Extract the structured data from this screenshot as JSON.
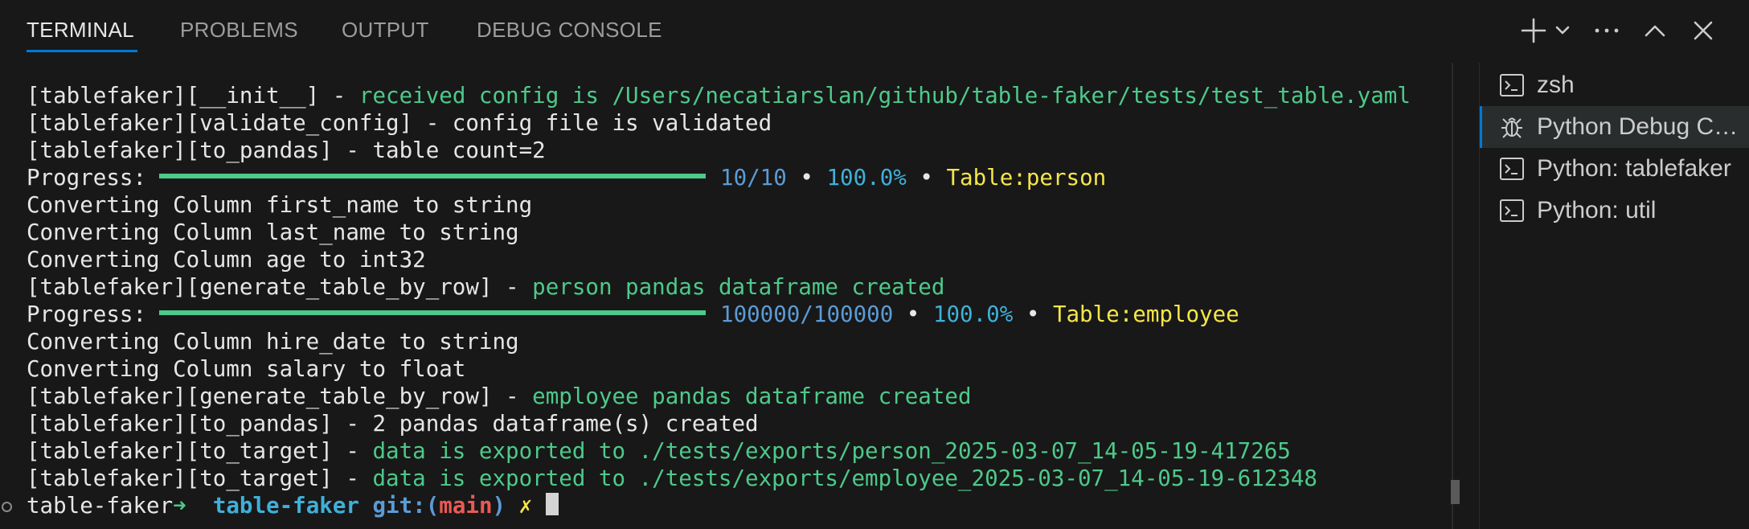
{
  "tabs": [
    {
      "label": "TERMINAL",
      "active": true
    },
    {
      "label": "PROBLEMS",
      "active": false
    },
    {
      "label": "OUTPUT",
      "active": false
    },
    {
      "label": "DEBUG CONSOLE",
      "active": false
    }
  ],
  "toolbar": {
    "icons": [
      "plus-icon",
      "chevron-down-icon",
      "ellipsis-icon",
      "chevron-up-icon",
      "close-icon"
    ]
  },
  "terminal": {
    "lines": {
      "l1": {
        "prefix": "[tablefaker][__init__] - ",
        "msg": "received config is /Users/necatiarslan/github/table-faker/tests/test_table.yaml"
      },
      "l2": {
        "text": "[tablefaker][validate_config] - config file is validated"
      },
      "l3": {
        "text": "[tablefaker][to_pandas] - table count=2"
      },
      "p1": {
        "label": "Progress:",
        "count": "10/10",
        "sep": " • ",
        "pct": "100.0%",
        "sep2": " • ",
        "table": "Table:person",
        "progress": 1.0
      },
      "l5": {
        "text": "Converting Column first_name to string"
      },
      "l6": {
        "text": "Converting Column last_name to string"
      },
      "l7": {
        "text": "Converting Column age to int32"
      },
      "l8": {
        "prefix": "[tablefaker][generate_table_by_row] - ",
        "msg": "person pandas dataframe created"
      },
      "p2": {
        "label": "Progress:",
        "count": "100000/100000",
        "sep": " • ",
        "pct": "100.0%",
        "sep2": " • ",
        "table": "Table:employee",
        "progress": 1.0
      },
      "l10": {
        "text": "Converting Column hire_date to string"
      },
      "l11": {
        "text": "Converting Column salary to float"
      },
      "l12": {
        "prefix": "[tablefaker][generate_table_by_row] - ",
        "msg": "employee pandas dataframe created"
      },
      "l13": {
        "text": "[tablefaker][to_pandas] - 2 pandas dataframe(s) created"
      },
      "l14": {
        "prefix": "[tablefaker][to_target] - ",
        "msg": "data is exported to ./tests/exports/person_2025-03-07_14-05-19-417265"
      },
      "l15": {
        "prefix": "[tablefaker][to_target] - ",
        "msg": "data is exported to ./tests/exports/employee_2025-03-07_14-05-19-612348"
      }
    },
    "prompt": {
      "host": "table-faker",
      "arrow": "➜ ",
      "dir": "table-faker",
      "git_open": "git:(",
      "branch": "main",
      "git_close": ")",
      "dirty": "✗"
    }
  },
  "terminal_list": [
    {
      "label": "zsh",
      "icon": "terminal-icon",
      "active": false
    },
    {
      "label": "Python Debug Console",
      "icon": "debug-icon",
      "active": true
    },
    {
      "label": "Python: tablefaker",
      "icon": "terminal-icon",
      "active": false
    },
    {
      "label": "Python: util",
      "icon": "terminal-icon",
      "active": false
    }
  ],
  "colors": {
    "background": "#181818",
    "accent": "#0078d4",
    "green": "#4ec98a",
    "blue": "#5b9bd5",
    "cyan": "#3fb0d9",
    "yellow": "#f5e64a",
    "red": "#ea5a53"
  }
}
